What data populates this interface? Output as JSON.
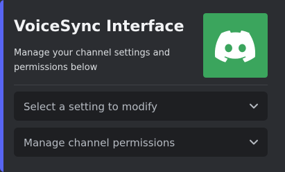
{
  "embed": {
    "title": "VoiceSync Interface",
    "description": "Manage your channel settings and permissions below",
    "thumbnail_icon": "discord-logo-icon",
    "accent_color": "#5865f2",
    "thumbnail_color": "#3ba55d"
  },
  "selects": [
    {
      "placeholder": "Select a setting to modify",
      "icon": "chevron-down-icon"
    },
    {
      "placeholder": "Manage channel permissions",
      "icon": "chevron-down-icon"
    }
  ]
}
